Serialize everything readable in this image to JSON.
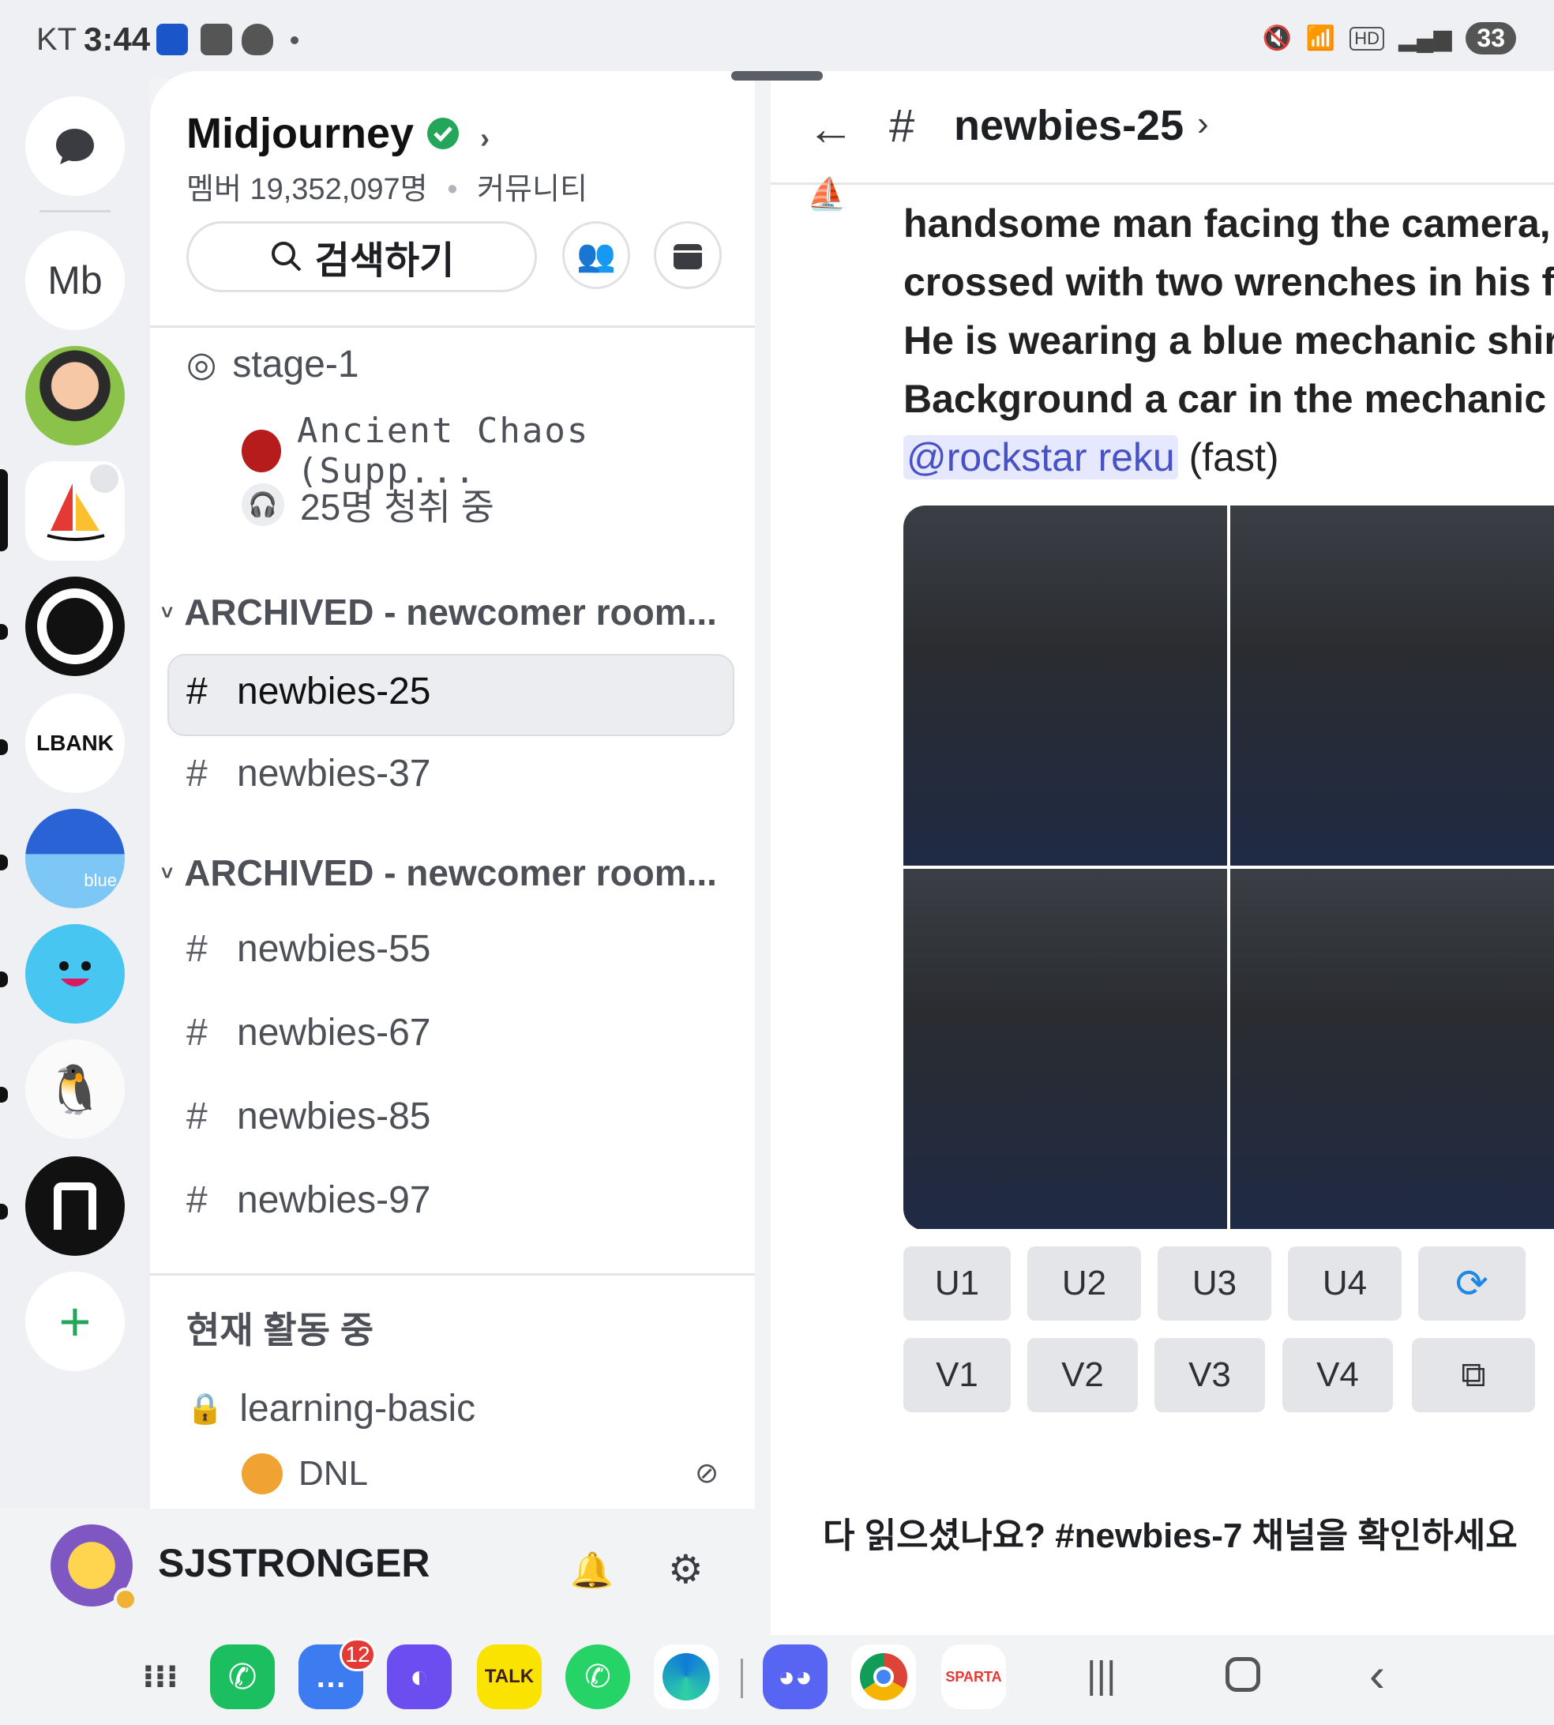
{
  "status_bar": {
    "carrier": "KT",
    "time": "3:44",
    "battery": "33"
  },
  "rail": {
    "dm_icon": "chat-bubble-icon",
    "servers": [
      {
        "name": "Mb",
        "label": "Mb"
      },
      {
        "name": "avatar-server"
      },
      {
        "name": "midjourney",
        "selected": true
      },
      {
        "name": "ring-server"
      },
      {
        "name": "lbank",
        "label": "LBANK"
      },
      {
        "name": "blue",
        "label": "blue"
      },
      {
        "name": "smiley-server"
      },
      {
        "name": "sticker-server"
      },
      {
        "name": "dark-server"
      }
    ],
    "add_label": "+"
  },
  "channels": {
    "server_name": "Midjourney",
    "member_count": "멤버 19,352,097명",
    "community": "커뮤니티",
    "search_label": "검색하기",
    "stage": {
      "name": "stage-1",
      "speaker": "Ancient Chaos (Supp...",
      "listeners": "25명 청취 중"
    },
    "category1": "ARCHIVED - newcomer room...",
    "cat1_items": [
      "newbies-25",
      "newbies-37"
    ],
    "category2": "ARCHIVED - newcomer room...",
    "cat2_items": [
      "newbies-55",
      "newbies-67",
      "newbies-85",
      "newbies-97"
    ],
    "active_section": "현재 활동 중",
    "voice": {
      "name": "learning-basic",
      "user": "DNL"
    }
  },
  "user": {
    "name": "SJSTRONGER"
  },
  "chat": {
    "channel_name": "newbies-25",
    "prompt_lines": [
      "handsome man facing the camera, l",
      "crossed with two wrenches in his fi",
      "He is wearing a blue mechanic shirt",
      "Background a car in the mechanic s"
    ],
    "mention": "@rockstar reku",
    "speed": "(fast)",
    "upscale_buttons": [
      "U1",
      "U2",
      "U3",
      "U4"
    ],
    "variation_buttons": [
      "V1",
      "V2",
      "V3",
      "V4"
    ],
    "footer": "다 읽으셨나요? #newbies-7 채널을 확인하세요"
  },
  "dock": {
    "messages_badge": "12",
    "apps": [
      "apps-grid",
      "phone",
      "messages",
      "internet",
      "kakaotalk",
      "whatsapp",
      "edge",
      "discord",
      "chrome",
      "sparta"
    ],
    "kakao_label": "TALK",
    "sparta_label": "SPARTA"
  },
  "colors": {
    "accent": "#5865f2",
    "verified": "#23a55a",
    "mention_bg": "#e6e8fd",
    "mention_fg": "#4752c4"
  }
}
